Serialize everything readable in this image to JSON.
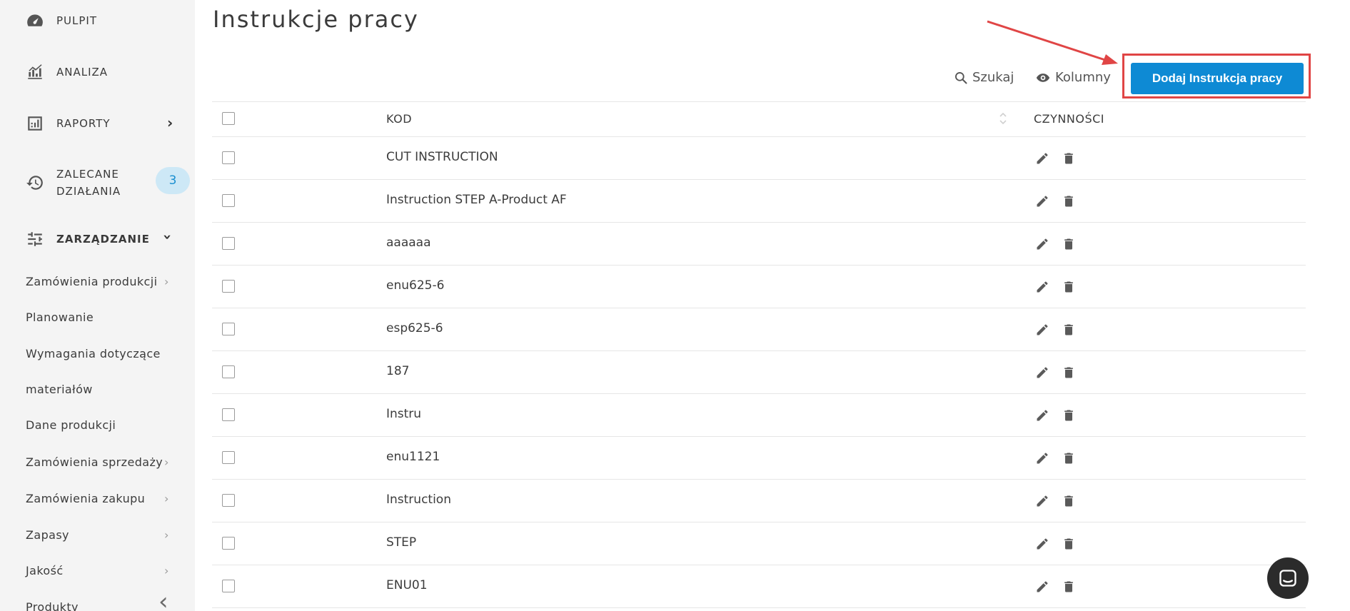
{
  "sidebar": {
    "main": [
      {
        "label": "PULPIT",
        "icon": "dashboard-gauge-icon"
      },
      {
        "label": "ANALIZA",
        "icon": "analytics-chart-icon"
      },
      {
        "label": "RAPORTY",
        "icon": "reports-icon"
      },
      {
        "label_line1": "ZALECANE",
        "label_line2": "DZIAŁANIA",
        "icon": "history-icon",
        "badge": "3"
      },
      {
        "label": "ZARZĄDZANIE",
        "icon": "sliders-icon"
      }
    ],
    "sub": [
      {
        "label": "Zamówienia produkcji"
      },
      {
        "label": "Planowanie"
      },
      {
        "label": "Wymagania dotyczące"
      },
      {
        "label": "materiałów"
      },
      {
        "label": "Dane produkcji"
      },
      {
        "label": "Zamówienia sprzedaży"
      },
      {
        "label": "Zamówienia zakupu"
      },
      {
        "label": "Zapasy"
      },
      {
        "label": "Jakość"
      },
      {
        "label": "Produkty"
      }
    ]
  },
  "page": {
    "title": "Instrukcje pracy",
    "search_label": "Szukaj",
    "columns_label": "Kolumny",
    "add_button_label": "Dodaj Instrukcja pracy"
  },
  "table": {
    "headers": {
      "kod": "KOD",
      "actions": "CZYNNOŚCI"
    },
    "rows": [
      {
        "kod": "CUT INSTRUCTION"
      },
      {
        "kod": "Instruction STEP A-Product AF"
      },
      {
        "kod": "aaaaaa"
      },
      {
        "kod": "enu625-6"
      },
      {
        "kod": "esp625-6"
      },
      {
        "kod": "187"
      },
      {
        "kod": "Instru"
      },
      {
        "kod": "enu1121"
      },
      {
        "kod": "Instruction"
      },
      {
        "kod": "STEP"
      },
      {
        "kod": "ENU01"
      }
    ]
  },
  "colors": {
    "accent": "#0e8ad4",
    "highlight": "#e04545",
    "sidebar_bg": "#f4f4f4",
    "badge_bg": "#cde8f6"
  }
}
